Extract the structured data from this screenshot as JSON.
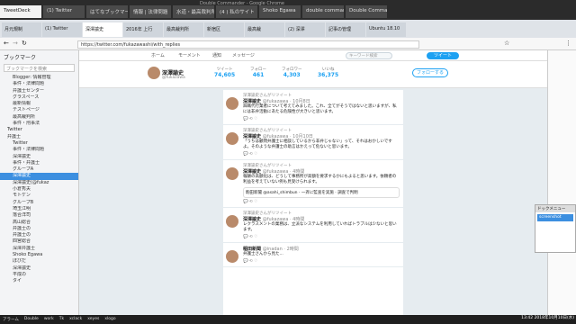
{
  "window": {
    "title": "Double Commander - Google Chrome"
  },
  "top_tabs": [
    "TweetDeck",
    "(1) Twitter",
    "はてなブックマーク",
    "情報 | 法律問題",
    "水道・最高裁判所",
    "(4 ) 私のサイト",
    "Shoko Egawa",
    "double commander",
    "Double Commander"
  ],
  "chrome_tabs": [
    "月元規制",
    "(1) Twitter",
    "深澤諭史",
    "2016年 上行",
    "最高裁判所",
    "新宿区",
    "最高裁",
    "(2) 深澤",
    "記事の管理",
    "Ubuntu 18.10"
  ],
  "address": "https://twitter.com/fukazawashi/with_replies",
  "sidebar": {
    "title": "ブックマーク",
    "search_placeholder": "ブックマークを検索",
    "items": [
      "Blogger: 情報管理",
      "事件・法律問題",
      "弁護士センター",
      "グラスペース",
      "最新情報",
      "テストページ",
      "最高裁判所",
      "事件・刑事法",
      "Twitter",
      "弁護士",
      "Twitter",
      "事件・法律問題",
      "深澤諭史",
      "事件・弁護士",
      "グループA",
      "深澤諭史",
      "深澤諭史(@fukaz",
      "小倉秀夫",
      "モトケン",
      "グループB",
      "埼玉江明",
      "落合洋司",
      "高山総合",
      "弁護士の",
      "弁護士の",
      "四宮総合",
      "深澤弁護士",
      "Shoko Egawa",
      "ぼびだ",
      "深澤諭史",
      "平成の",
      "タイ"
    ]
  },
  "nav": {
    "home": "ホーム",
    "moments": "モーメント",
    "notifications": "通知",
    "messages": "メッセージ",
    "search_placeholder": "キーワード検索",
    "tweet": "ツイート"
  },
  "profile": {
    "name": "深澤諭史",
    "handle": "@fukazawa",
    "stats": [
      {
        "label": "ツイート",
        "value": "74,605"
      },
      {
        "label": "フォロー",
        "value": "461"
      },
      {
        "label": "フォロワー",
        "value": "4,303"
      },
      {
        "label": "いいね",
        "value": "36,375"
      }
    ],
    "follow_button": "フォローする"
  },
  "tweets": [
    {
      "rt": "深澤諭史さんがリツイート",
      "name": "深澤諭史",
      "meta": "@fukazawa · 10月8日",
      "text": "辞職代行業者について考えてみました。これ、全てがそうではないと思いますが、私には非弁活動にあたる危険性が大きいと思います。"
    },
    {
      "rt": "深澤諭史さんがリツイート",
      "name": "深澤諭史",
      "meta": "@fukazawa · 10月10日",
      "text": "「うちは顧問弁護士に相談しているから非弁じゃない」って、それはおかしいですよ。そのような弁護士の助言はかえって危ないと思います。"
    },
    {
      "rt": "深澤諭史さんがリツイート",
      "name": "深澤諭史",
      "meta": "@fukazawa · 4時間",
      "text": "報酬の高額化は、どうして事務所が高額を要求するかにもよると思います。依頼者の利益を考えていない例も見受けられます。",
      "quote": "駒田新聞 @asahi_shimbun · 一斉に監査を実施 · 調査で判明"
    },
    {
      "rt": "深澤諭史さんがリツイート",
      "name": "深澤諭史",
      "meta": "@fukazawa · 4時間",
      "text": "レクラスメントの業務は、立派なシステムを利用していればトラブルは少ないと思います。"
    },
    {
      "rt": "",
      "name": "稲田新聞",
      "meta": "@inadan · 2時間",
      "text": "弁護士さんから見た..."
    }
  ],
  "popup": {
    "title": "ドックメニュー",
    "item": "screenshot"
  },
  "taskbar": {
    "items": [
      "アラーム",
      "Double",
      "work",
      "Tk",
      "xclack",
      "xeyes",
      "xlogo"
    ],
    "clock": "13:42  2018年10月10日(水)"
  },
  "icon_names": [
    "back-icon",
    "forward-icon",
    "reload-icon",
    "star-icon",
    "menu-icon"
  ]
}
